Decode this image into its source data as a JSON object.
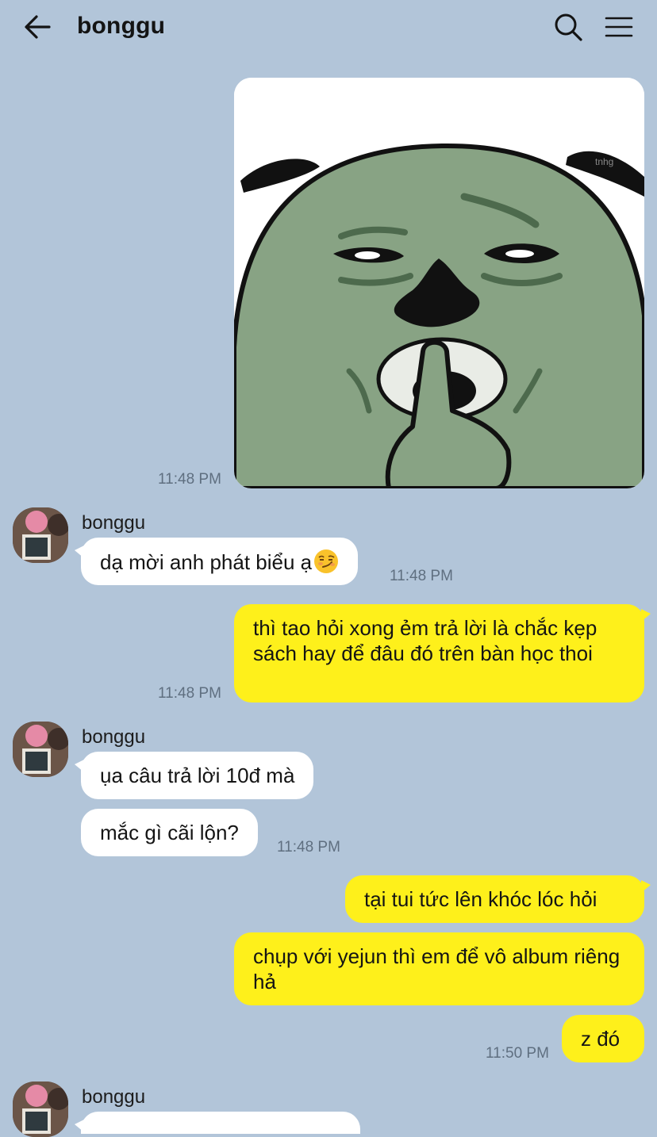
{
  "header": {
    "title": "bonggu",
    "back_icon": "arrow-left-icon",
    "search_icon": "search-icon",
    "menu_icon": "hamburger-menu-icon"
  },
  "colors": {
    "background": "#b2c5d9",
    "incoming_bubble": "#ffffff",
    "outgoing_bubble": "#fef01b",
    "timestamp": "#5f6f80"
  },
  "messages": {
    "m1": {
      "type": "image-sticker",
      "direction": "outgoing",
      "watermark": "tnhg",
      "time": "11:48 PM"
    },
    "g1": {
      "sender": "bonggu",
      "text": "dạ mời anh phát biểu ạ",
      "emoji": "smirking-face-emoji",
      "time": "11:48 PM"
    },
    "m2": {
      "direction": "outgoing",
      "text": "thì tao hỏi xong ẻm trả lời là chắc kẹp sách hay để đâu đó trên bàn học thoi",
      "time": "11:48 PM"
    },
    "g2": {
      "sender": "bonggu",
      "text1": "ụa câu trả lời 10đ mà",
      "text2": "mắc gì cãi lộn?",
      "time": "11:48 PM"
    },
    "m3": {
      "direction": "outgoing",
      "text1": "tại tui tức lên khóc lóc hỏi",
      "text2": "chụp với yejun thì em để vô album riêng hả",
      "text3": "z đó",
      "time": "11:50 PM"
    },
    "g3": {
      "sender": "bonggu"
    }
  }
}
